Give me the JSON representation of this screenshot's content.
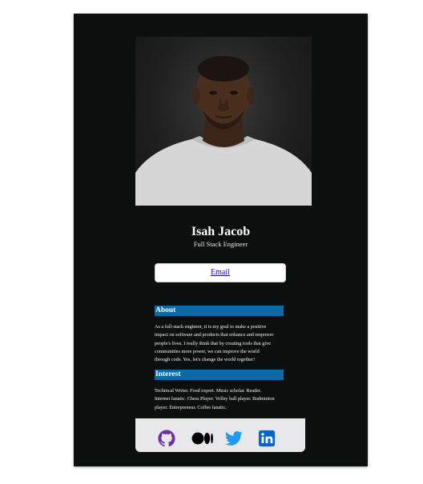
{
  "profile": {
    "name": "Isah Jacob",
    "role": "Full Stack Engineer"
  },
  "actions": {
    "email_label": "Email"
  },
  "about": {
    "heading": "About",
    "lines": [
      "As a full-stack engineer, it is my goal to make a positive",
      "impact on software and products that enhance and empower",
      "people's lives. I really think that by creating tools that give",
      "communities more power, we can improve the world",
      "through code. Yes, let's change the world together!"
    ]
  },
  "interest": {
    "heading": "Interest",
    "lines": [
      "Technical Writer. Food expert. Music scholar. Reader.",
      "Internet fanatic. Chess Player. Volley ball player. Badminton",
      "player. Entrepreneur. Coffee fanatic."
    ]
  },
  "social": {
    "icons": [
      "github-icon",
      "medium-icon",
      "twitter-icon",
      "linkedin-icon"
    ]
  },
  "colors": {
    "card_background": "#0b100f",
    "section_heading": "#0a6aa8",
    "social_bar": "#e8e8ea",
    "github": "#6e2fa0",
    "twitter": "#1d9bf0",
    "linkedin": "#0a66c2"
  }
}
